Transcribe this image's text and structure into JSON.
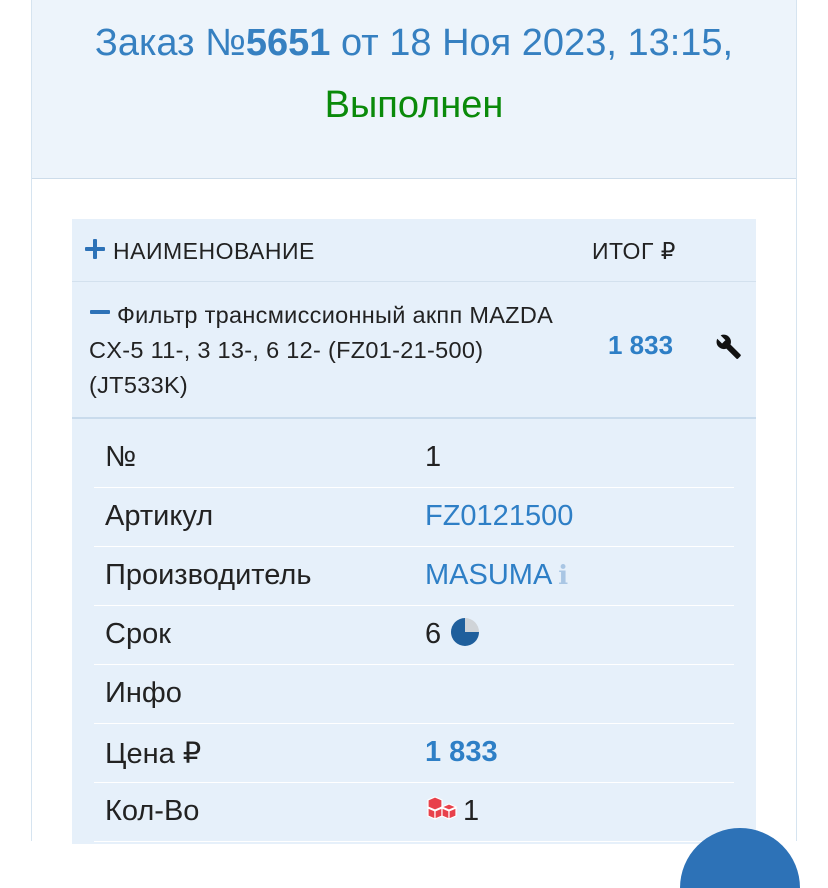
{
  "order": {
    "prefix": "Заказ №",
    "number": "5651",
    "date_text": " от 18 Ноя 2023, 13:15,",
    "status": "Выполнен"
  },
  "table": {
    "col_name": "НАИМЕНОВАНИЕ",
    "col_total": "ИТОГ ₽"
  },
  "item": {
    "name": "Фильтр трансмиссионный акпп MAZDA CX-5 11-, 3 13-, 6 12- (FZ01-21-500) (JT533K)",
    "total": "1 833"
  },
  "details": [
    {
      "label": "№",
      "value": "1"
    },
    {
      "label": "Артикул",
      "value": "FZ0121500"
    },
    {
      "label": "Производитель",
      "value": "MASUMA"
    },
    {
      "label": "Срок",
      "value": "6"
    },
    {
      "label": "Инфо",
      "value": ""
    },
    {
      "label": "Цена ₽",
      "value": "1 833"
    },
    {
      "label": "Кол-Во",
      "value": "1"
    }
  ],
  "colors": {
    "accent": "#2e7fc6",
    "status_green": "#0a8a0a",
    "header_bg": "#edf4fb",
    "row_bg": "#e6f0fa"
  },
  "icons": {
    "expand": "plus-icon",
    "collapse": "minus-icon",
    "service": "wrench-icon",
    "manufacturer_info": "info-icon",
    "delivery_term": "pie-icon",
    "quantity": "boxes-icon"
  }
}
